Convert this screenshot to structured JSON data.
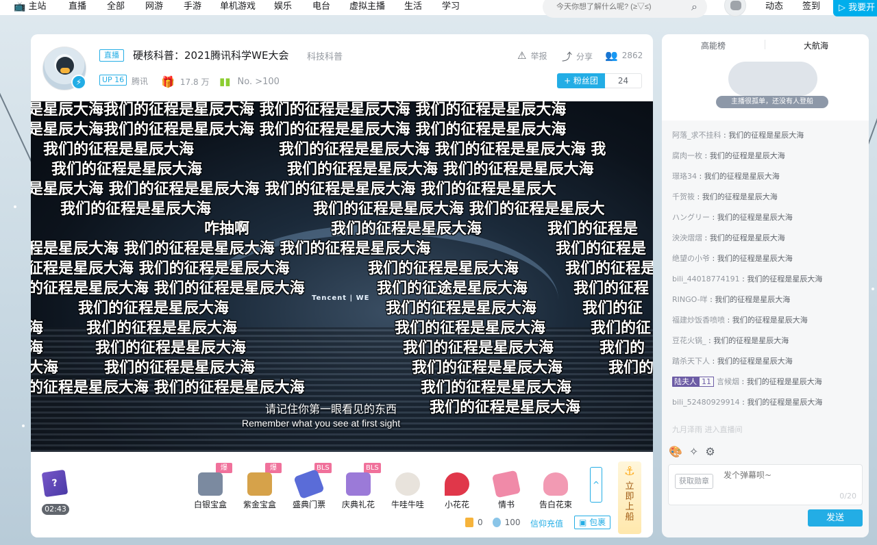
{
  "nav": {
    "items": [
      "主站",
      "直播",
      "全部",
      "网游",
      "手游",
      "单机游戏",
      "娱乐",
      "电台",
      "虚拟主播",
      "生活",
      "学习"
    ],
    "search_placeholder": "今天你想了解什么呢? (≥▽≤)",
    "dynamics": "动态",
    "signin": "签到",
    "start_live": "我要开"
  },
  "room": {
    "live_tag": "直播",
    "title": "硬核科普：2021腾讯科学WE大会",
    "area": "科技科普",
    "up_tag": "UP 16",
    "streamer": "腾讯",
    "gift_value": "17.8 万",
    "rank": "No. >100",
    "report": "举报",
    "share": "分享",
    "viewers": "2862",
    "fan_club": "+ 粉丝团",
    "fan_count": "24"
  },
  "player": {
    "danmaku": [
      "是星辰大海我们的征程是星辰大海  我们的征程是星辰大海 我们的征程是星辰大海",
      "是星辰大海我们的征程是星辰大海  我们的征程是星辰大海 我们的征程是星辰大海",
      "我们的征程是星辰大海",
      "我们的征程是星辰大海 我们的征程是星辰大海  我",
      "我们的征程是星辰大海",
      "我们的征程是星辰大海 我们的征程是星辰大海",
      "是星辰大海   我们的征程是星辰大海 我们的征程是星辰大海 我们的征程是星辰大",
      "我们的征程是星辰大海",
      "我们的征程是星辰大海 我们的征程是星辰大",
      "咋抽啊",
      "我们的征程是星辰大海",
      "我们的征程是",
      "程是星辰大海   我们的征程是星辰大海  我们的征程是星辰大海",
      "我们的征程是",
      "征程是星辰大海   我们的征程是星辰大海",
      "我们的征程是星辰大海",
      "我们的征程是",
      "的征程是星辰大海   我们的征程是星辰大海",
      "我们的征途是星辰大海",
      "我们的征程",
      "我们的征程是星辰大海",
      "我们的征程是星辰大海",
      "我们的征",
      "海",
      "我们的征程是星辰大海",
      "我们的征程是星辰大海",
      "我们的征",
      "海",
      "我们的征程是星辰大海",
      "我们的征程是星辰大海",
      "我们的",
      "大海",
      "我们的征程是星辰大海",
      "我们的征程是星辰大海",
      "我们的",
      "的征程是星辰大海   我们的征程是星辰大海",
      "我们的征程是星辰大海",
      "我们的征程是星辰大海"
    ],
    "subtitle_cn": "请记住你第一眼看见的东西",
    "subtitle_en": "Remember what you see at first sight",
    "stage_logo": "Tencent | WE"
  },
  "gifts": {
    "quiz_mark": "?",
    "timer": "02:43",
    "items": [
      {
        "name": "白银宝盒",
        "badge": "爆奖",
        "color": "#7b8aa0"
      },
      {
        "name": "紫金宝盒",
        "badge": "爆奖",
        "color": "#d6a24a"
      },
      {
        "name": "盛典门票",
        "badge": "BLS",
        "color": "#5a6cd8"
      },
      {
        "name": "庆典礼花",
        "badge": "BLS",
        "color": "#9b7ad8"
      },
      {
        "name": "牛哇牛哇",
        "badge": "",
        "color": "#d7d2cb"
      },
      {
        "name": "小花花",
        "badge": "",
        "color": "#e0374a"
      },
      {
        "name": "情书",
        "badge": "",
        "color": "#f08aa8"
      },
      {
        "name": "告白花束",
        "badge": "",
        "color": "#f29ab3"
      }
    ],
    "expand_icon": "^",
    "board_text": "立即上船",
    "gold": "0",
    "silver": "100",
    "recharge": "信仰充值",
    "pack": "包裹"
  },
  "side": {
    "tab_energy": "高能榜",
    "tab_guard": "大航海",
    "empty_text": "主播很孤单，还没有人登船",
    "chats": [
      {
        "user": "阿落_求不挂科",
        "text": "我们的征程是星辰大海"
      },
      {
        "user": "腐肉一枚",
        "text": "我们的征程是星辰大海"
      },
      {
        "user": "璟珞34",
        "text": "我们的征程是星辰大海"
      },
      {
        "user": "千贺筱",
        "text": "我们的征程是星辰大海"
      },
      {
        "user": "ハングリー",
        "text": "我们的征程是星辰大海"
      },
      {
        "user": "泱泱熠熠",
        "text": "我们的征程是星辰大海"
      },
      {
        "user": "绝望の小爷",
        "text": "我们的征程是星辰大海"
      },
      {
        "user": "bili_44018774191",
        "text": "我们的征程是星辰大海"
      },
      {
        "user": "RINGO-咩",
        "text": "我们的征程是星辰大海"
      },
      {
        "user": "福建炒饭香喷喷",
        "text": "我们的征程是星辰大海"
      },
      {
        "user": "豆花火锅_",
        "text": "我们的征程是星辰大海"
      },
      {
        "user": "踏杀天下人",
        "text": "我们的征程是星辰大海"
      },
      {
        "user": "言候烟",
        "text": "我们的征程是星辰大海",
        "medal": "陆夫人",
        "level": "11"
      },
      {
        "user": "bili_52480929914",
        "text": "我们的征程是星辰大海"
      }
    ],
    "enter_text": "九月泽雨 进入直播间",
    "medal_btn": "获取勋章",
    "input_placeholder": "发个弹幕呗~",
    "char_count": "0/20",
    "send": "发送"
  }
}
